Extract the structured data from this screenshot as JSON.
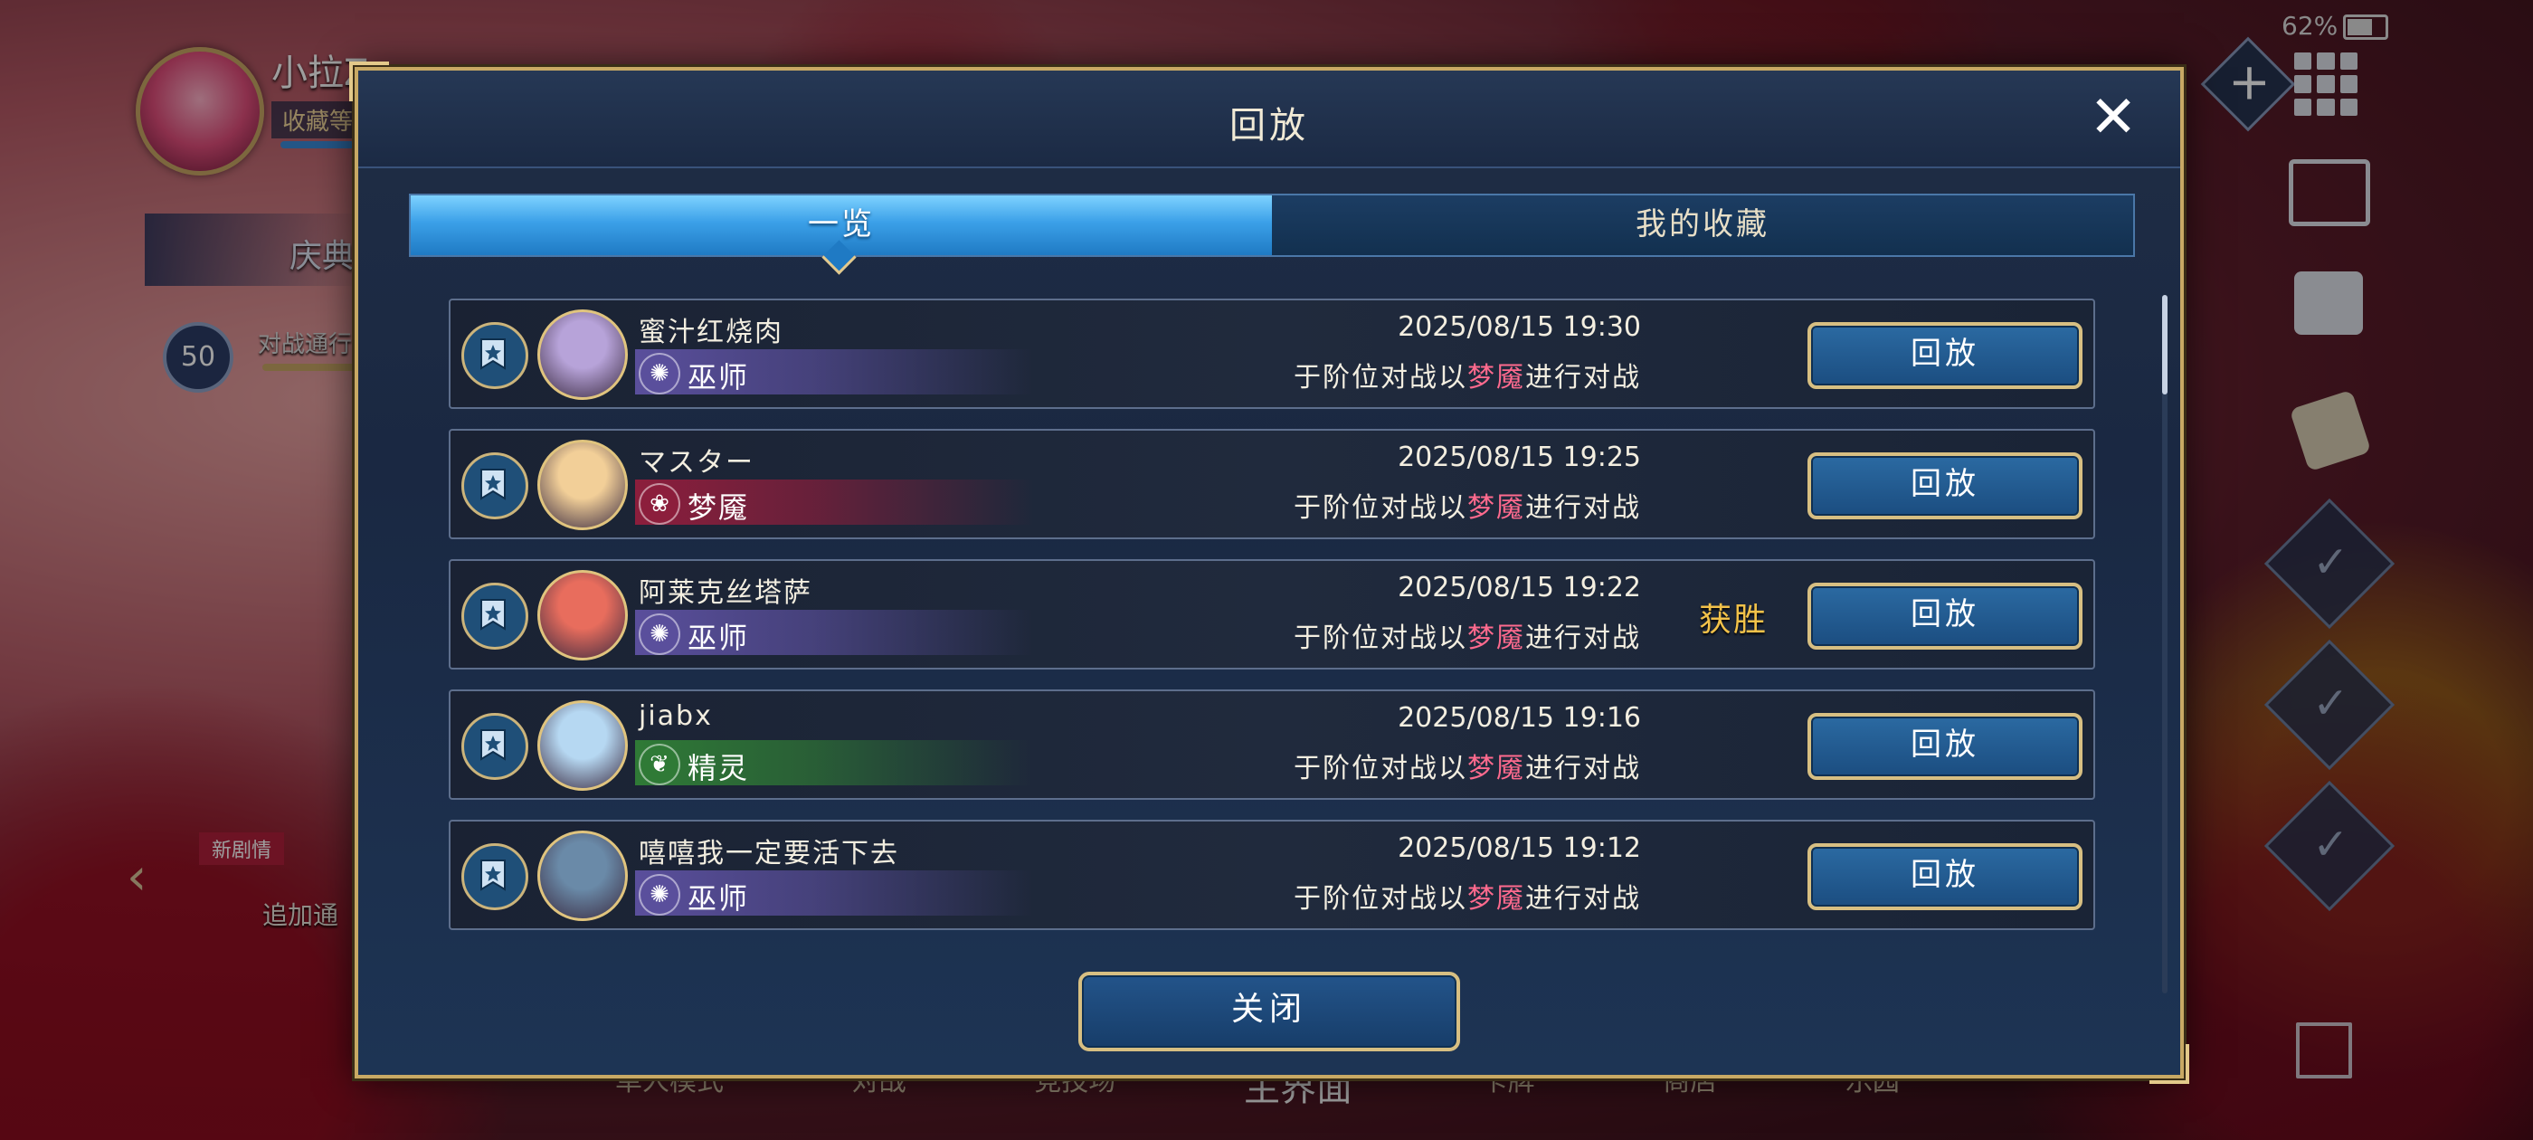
{
  "background": {
    "player_name": "小拉Z",
    "rank_label": "收藏等",
    "festival_label": "庆典",
    "level": "50",
    "pass_label": "对战通行证 第",
    "new_story_label": "新剧情",
    "add_label": "追加通",
    "battery": "62%",
    "bottom_nav": [
      "单人模式",
      "对战",
      "竞技场",
      "主界面",
      "卡牌",
      "商店",
      "乐园"
    ]
  },
  "modal": {
    "title": "回放",
    "close_icon": "close-icon",
    "tabs": [
      {
        "label": "一览",
        "active": true
      },
      {
        "label": "我的收藏",
        "active": false
      }
    ],
    "replays": [
      {
        "player": "蜜汁红烧肉",
        "class": "巫师",
        "class_color": "#5a4f9c",
        "avatar_color": "#b7a3d9",
        "datetime": "2025/08/15  19:30",
        "desc_pre": "于阶位对战以",
        "desc_hl": "梦魇",
        "desc_post": "进行对战",
        "result": "",
        "button": "回放"
      },
      {
        "player": "マスター",
        "class": "梦魇",
        "class_color": "#8c1e3c",
        "avatar_color": "#f2cf98",
        "datetime": "2025/08/15  19:25",
        "desc_pre": "于阶位对战以",
        "desc_hl": "梦魇",
        "desc_post": "进行对战",
        "result": "",
        "button": "回放"
      },
      {
        "player": "阿莱克丝塔萨",
        "class": "巫师",
        "class_color": "#5a4f9c",
        "avatar_color": "#e86d5d",
        "datetime": "2025/08/15  19:22",
        "desc_pre": "于阶位对战以",
        "desc_hl": "梦魇",
        "desc_post": "进行对战",
        "result": "获胜",
        "button": "回放"
      },
      {
        "player": "jiabx",
        "class": "精灵",
        "class_color": "#2f7a36",
        "avatar_color": "#b6d8f2",
        "datetime": "2025/08/15  19:16",
        "desc_pre": "于阶位对战以",
        "desc_hl": "梦魇",
        "desc_post": "进行对战",
        "result": "",
        "button": "回放"
      },
      {
        "player": "嘻嘻我一定要活下去",
        "class": "巫师",
        "class_color": "#5a4f9c",
        "avatar_color": "#6a8aa8",
        "datetime": "2025/08/15  19:12",
        "desc_pre": "于阶位对战以",
        "desc_hl": "梦魇",
        "desc_post": "进行对战",
        "result": "",
        "button": "回放"
      }
    ],
    "close_button": "关闭"
  },
  "colors": {
    "accent_gold": "#c8a964",
    "tab_active": "#3ba0e8",
    "highlight_red": "#ff6a8e",
    "win_gold": "#f2c24a"
  }
}
